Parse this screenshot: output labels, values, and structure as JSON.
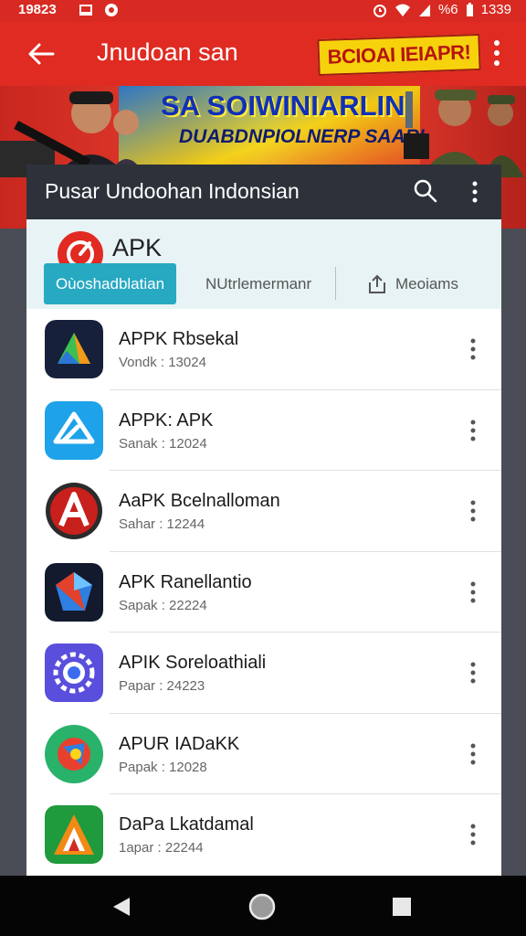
{
  "status_bar": {
    "time": "19823",
    "right_text": "%6",
    "clock": "1339"
  },
  "appbar": {
    "title": "Jnudoan san",
    "promo": "BCIOAI IEIAPR!"
  },
  "banner": {
    "headline": "SA SOIWINIARLIN",
    "subheadline": "DUABDNPIOLNERP SAARI"
  },
  "card": {
    "title": "Pusar Undoohan Indonsian",
    "section_label": "APK",
    "tabs": [
      {
        "label": "Oùoshadblatian"
      },
      {
        "label": "NUtrlemermanr"
      },
      {
        "label": "Meoiams"
      }
    ]
  },
  "apps": [
    {
      "name": "APPK Rbsekal",
      "sub": "Vondk : 13024",
      "icon": "green-triangle-icon"
    },
    {
      "name": "APPK: APK",
      "sub": "Sanak : 12024",
      "icon": "blue-triangle-icon"
    },
    {
      "name": "AaPK Bcelnalloman",
      "sub": "Sahar : 12244",
      "icon": "red-a-icon"
    },
    {
      "name": "APK Ranellantio",
      "sub": "Sapak : 22224",
      "icon": "blue-gem-icon"
    },
    {
      "name": "APIK Soreloathiali",
      "sub": "Papar : 24223",
      "icon": "purple-gear-icon"
    },
    {
      "name": "APUR IADaKK",
      "sub": "Papak : 12028",
      "icon": "green-circle-icon"
    },
    {
      "name": "DaPa Lkatdamal",
      "sub": "1apar : 22244",
      "icon": "green-delta-icon"
    }
  ],
  "colors": {
    "brand_red": "#df2b22",
    "accent_teal": "#27a9c2",
    "card_header": "#2d323a"
  }
}
